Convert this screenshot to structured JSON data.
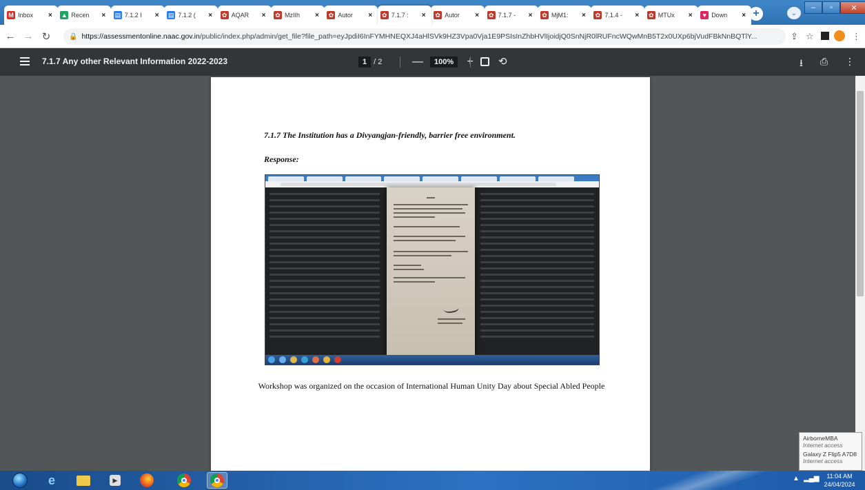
{
  "browser": {
    "tabs": [
      {
        "label": "Inbox",
        "icon": "gmail-icon",
        "color": "#d93025",
        "glyph": "M"
      },
      {
        "label": "Recen",
        "icon": "drive-icon",
        "color": "#1fa463",
        "glyph": "▲"
      },
      {
        "label": "7.1.2 I",
        "icon": "sheets-icon",
        "color": "#2b7de9",
        "glyph": "▤"
      },
      {
        "label": "7.1.2 (",
        "icon": "sheets-icon",
        "color": "#2b7de9",
        "glyph": "▤"
      },
      {
        "label": "AQAR",
        "icon": "naac-icon",
        "color": "#c0392b",
        "glyph": "✿"
      },
      {
        "label": "MzIIh",
        "icon": "naac-icon",
        "color": "#c0392b",
        "glyph": "✿"
      },
      {
        "label": "Autor",
        "icon": "naac-icon",
        "color": "#c0392b",
        "glyph": "✿"
      },
      {
        "label": "7.1.7 :",
        "icon": "naac-icon",
        "color": "#c0392b",
        "glyph": "✿"
      },
      {
        "label": "Autor",
        "icon": "naac-icon",
        "color": "#c0392b",
        "glyph": "✿"
      },
      {
        "label": "7.1.7 -",
        "icon": "naac-icon",
        "color": "#c0392b",
        "glyph": "✿"
      },
      {
        "label": "MjM1:",
        "icon": "naac-icon",
        "color": "#c0392b",
        "glyph": "✿"
      },
      {
        "label": "7.1.4 -",
        "icon": "naac-icon",
        "color": "#c0392b",
        "glyph": "✿"
      },
      {
        "label": "MTUx",
        "icon": "naac-icon",
        "color": "#c0392b",
        "glyph": "✿"
      },
      {
        "label": "Down",
        "icon": "download-site-icon",
        "color": "#e0245e",
        "glyph": "♥"
      }
    ],
    "tab_close": "×",
    "new_tab": "+",
    "active_tab_index": 7,
    "url_host": "https://assessmentonline.naac.gov.in",
    "url_path": "/public/index.php/admin/get_file?file_path=eyJpdiI6InFYMHNEQXJ4aHlSVk9HZ3Vpa0Vja1E9PSIsInZhbHVlIjoidjQ0SnNjR0lRUFncWQwMnB5T2x0UXp6bjVudFBkNnBQTlY..."
  },
  "pdf_toolbar": {
    "title": "7.1.7 Any other Relevant Information 2022-2023",
    "page_current": "1",
    "page_total": "/ 2",
    "zoom_minus": "—",
    "zoom_value": "100%",
    "zoom_plus": "+"
  },
  "page": {
    "heading": "7.1.7 The Institution has a Divyangjan-friendly, barrier free environment.",
    "response_label": "Response:",
    "caption": "Workshop was organized on the occasion of International Human Unity Day about Special Abled People"
  },
  "network_popup": {
    "items": [
      {
        "name": "AirborneMBA",
        "status": "Internet access"
      },
      {
        "name": "Galaxy Z Flip5 A7D8",
        "status": "Internet access"
      }
    ]
  },
  "taskbar": {
    "time": "11:04 AM",
    "date": "24/04/2024"
  },
  "colors": {
    "chrome_blue": "#2f73b4",
    "pdf_toolbar": "#323639",
    "viewer_bg": "#525659"
  }
}
